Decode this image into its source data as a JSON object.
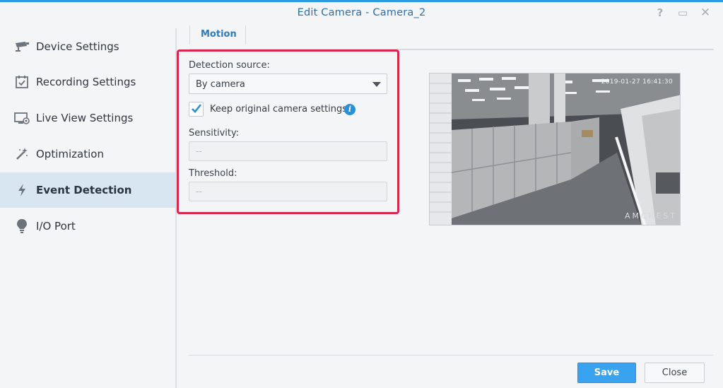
{
  "window": {
    "title": "Edit Camera - Camera_2",
    "help_icon": "?",
    "maximize_icon": "▭",
    "close_icon": "✕"
  },
  "sidebar": {
    "items": [
      {
        "label": "Device Settings",
        "icon": "camera-icon"
      },
      {
        "label": "Recording Settings",
        "icon": "calendar-check-icon"
      },
      {
        "label": "Live View Settings",
        "icon": "monitor-icon"
      },
      {
        "label": "Optimization",
        "icon": "magic-wand-icon"
      },
      {
        "label": "Event Detection",
        "icon": "lightning-icon",
        "active": true
      },
      {
        "label": "I/O Port",
        "icon": "bulb-icon"
      }
    ]
  },
  "tabs": [
    {
      "label": "Motion",
      "active": true
    }
  ],
  "form": {
    "detection_source_label": "Detection source:",
    "detection_source_value": "By camera",
    "keep_settings_label": "Keep original camera settings",
    "keep_settings_checked": true,
    "sensitivity_label": "Sensitivity:",
    "sensitivity_value": "--",
    "threshold_label": "Threshold:",
    "threshold_value": "--"
  },
  "preview": {
    "timestamp": "2019-01-27 16:41:30",
    "brand": "AMCREST"
  },
  "footer": {
    "save_label": "Save",
    "close_label": "Close"
  },
  "colors": {
    "accent": "#2a9be0",
    "highlight": "#d8284f",
    "save_button": "#3aa3f0",
    "active_item": "#d8e6f1"
  }
}
